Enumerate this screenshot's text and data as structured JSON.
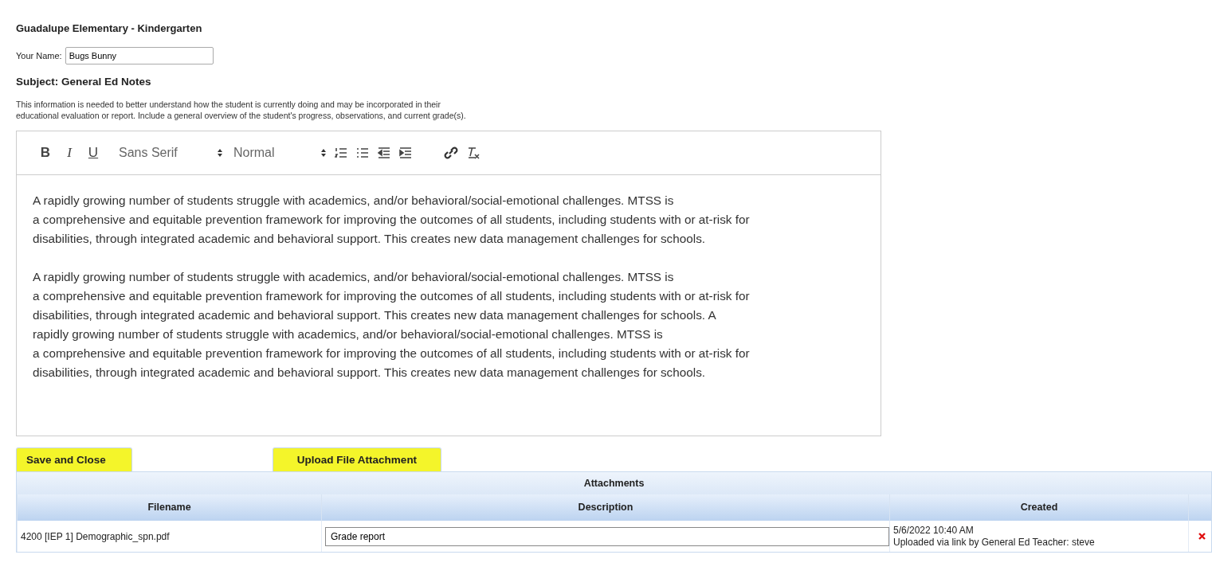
{
  "page": {
    "title": "Guadalupe Elementary - Kindergarten"
  },
  "name_field": {
    "label": "Your Name:",
    "value": "Bugs Bunny"
  },
  "subject": "Subject: General Ed Notes",
  "instructions": [
    "This information is needed to better understand how the student is currently doing and may be incorporated in their",
    "educational evaluation or report. Include a general overview of the student's progress, observations, and current grade(s)."
  ],
  "editor": {
    "toolbar": {
      "format_buttons": [
        {
          "label": "B",
          "kind": "bold"
        },
        {
          "label": "I",
          "kind": "italic"
        },
        {
          "label": "U",
          "kind": "underline"
        }
      ],
      "font": "Sans Serif",
      "size": "Normal"
    },
    "paragraphs": [
      [
        "A rapidly growing number of students struggle with academics, and/or behavioral/social-emotional challenges. MTSS is",
        "a comprehensive and equitable prevention framework for improving the outcomes of all students, including students with or at-risk for",
        "disabilities, through integrated academic and behavioral support. This creates new data management challenges for schools."
      ],
      [
        "A rapidly growing number of students struggle with academics, and/or behavioral/social-emotional challenges. MTSS is",
        "a comprehensive and equitable prevention framework for improving the outcomes of all students, including students with or at-risk for",
        "disabilities, through integrated academic and behavioral support. This creates new data management challenges for schools. A",
        "rapidly growing number of students struggle with academics, and/or behavioral/social-emotional challenges. MTSS is",
        "a comprehensive and equitable prevention framework for improving the outcomes of all students, including students with or at-risk for",
        "disabilities, through integrated academic and behavioral support. This creates new data management challenges for schools."
      ]
    ]
  },
  "buttons": [
    {
      "label": "Save and Close",
      "highlighted": true
    },
    {
      "label": "Upload File Attachment",
      "highlighted": true
    }
  ],
  "attachments": {
    "title": "Attachments",
    "columns": [
      "Filename",
      "Description",
      "Created"
    ],
    "rows": [
      {
        "filename": "4200 [IEP 1] Demographic_spn.pdf",
        "description": "Grade report",
        "created": [
          "5/6/2022 10:40 AM",
          "Uploaded via link by General Ed Teacher: steve"
        ]
      }
    ]
  }
}
